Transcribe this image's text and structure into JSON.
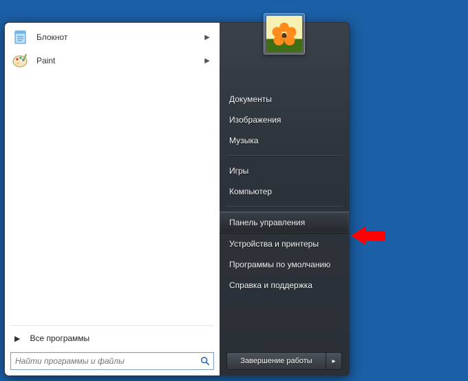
{
  "left": {
    "programs": [
      {
        "label": "Блокнот",
        "icon": "notepad-icon",
        "has_submenu": true
      },
      {
        "label": "Paint",
        "icon": "paint-icon",
        "has_submenu": true
      }
    ],
    "all_programs_label": "Все программы",
    "search_placeholder": "Найти программы и файлы"
  },
  "right": {
    "items": [
      {
        "label": "Документы",
        "highlight": false
      },
      {
        "label": "Изображения",
        "highlight": false
      },
      {
        "label": "Музыка",
        "highlight": false
      },
      {
        "sep": true
      },
      {
        "label": "Игры",
        "highlight": false
      },
      {
        "label": "Компьютер",
        "highlight": false
      },
      {
        "sep": true
      },
      {
        "label": "Панель управления",
        "highlight": true
      },
      {
        "label": "Устройства и принтеры",
        "highlight": false
      },
      {
        "label": "Программы по умолчанию",
        "highlight": false
      },
      {
        "label": "Справка и поддержка",
        "highlight": false
      }
    ],
    "shutdown_label": "Завершение работы"
  },
  "annotation": {
    "target_item_index": 7,
    "color": "#ff0000"
  }
}
